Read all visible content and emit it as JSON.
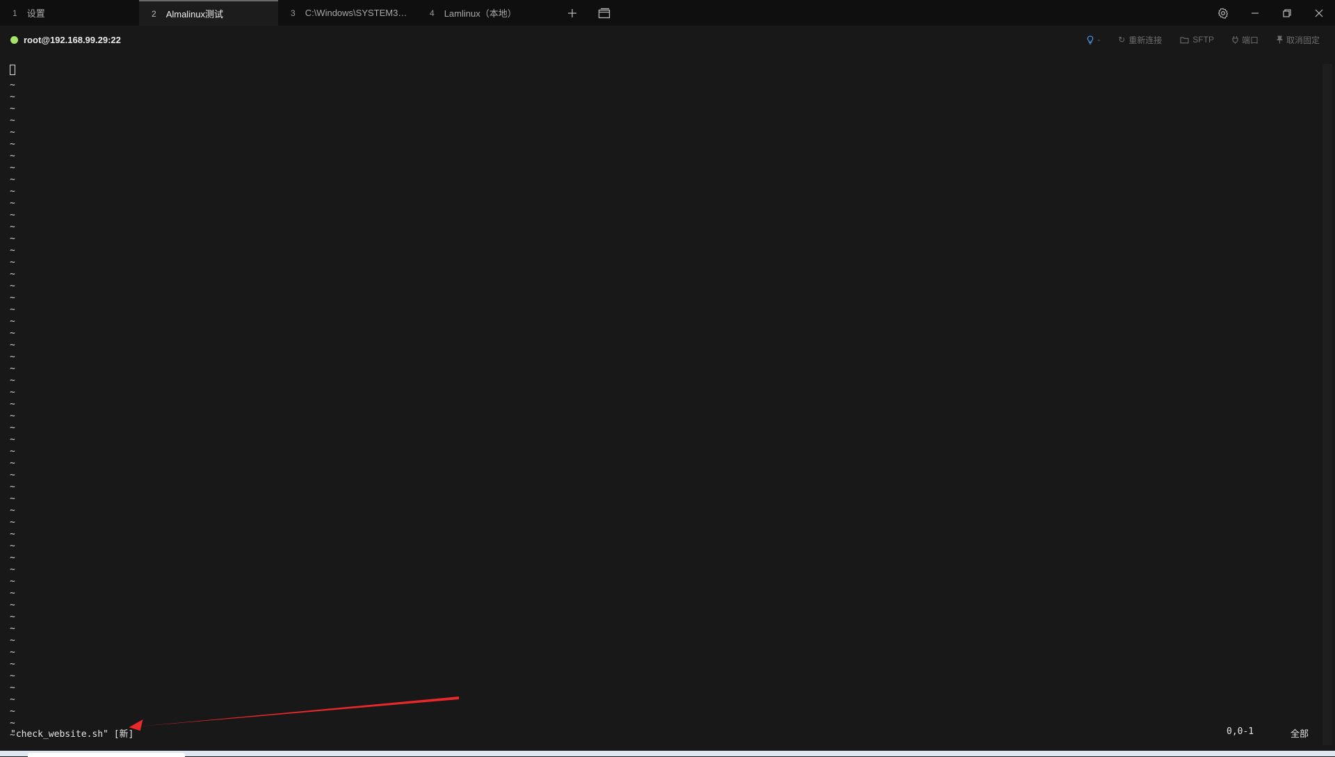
{
  "tabs": [
    {
      "num": "1",
      "label": "设置",
      "active": false
    },
    {
      "num": "2",
      "label": "Almalinux测试",
      "active": true
    },
    {
      "num": "3",
      "label": "C:\\Windows\\SYSTEM3…",
      "active": false
    },
    {
      "num": "4",
      "label": "Lamlinux（本地）",
      "active": false
    }
  ],
  "icons": {
    "new_tab": "plus-icon",
    "tab_overview": "windows-icon",
    "settings": "gear-icon",
    "minimize": "minimize-icon",
    "restore": "restore-icon",
    "close": "close-icon"
  },
  "session": {
    "title": "root@192.168.99.29:22",
    "status_color": "#a6e36b",
    "tools": {
      "bulb": "-",
      "reconnect": "重新连接",
      "sftp": "SFTP",
      "port": "端口",
      "unpin": "取消固定"
    }
  },
  "terminal": {
    "tilde": "~",
    "tilde_count": 56,
    "status_file": "\"check_website.sh\" [新]",
    "status_pos": "0,0-1",
    "status_all": "全部"
  },
  "colors": {
    "background": "#181818",
    "tabbar": "#0f0f0f",
    "annotation_arrow": "#e8282b"
  }
}
